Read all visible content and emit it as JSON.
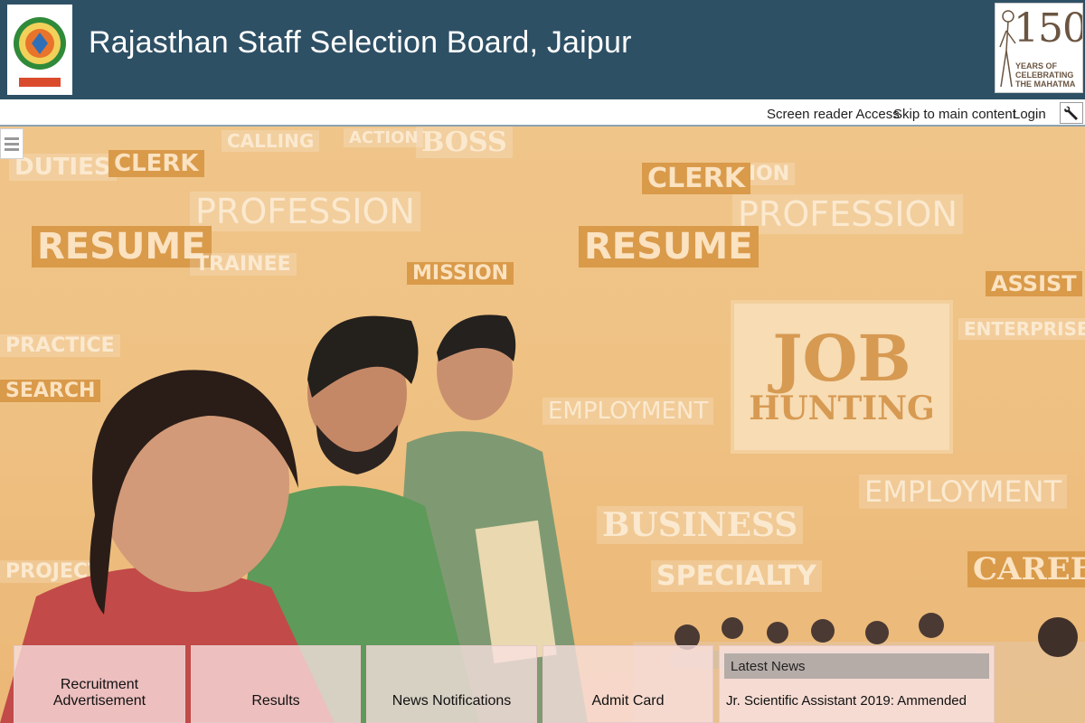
{
  "header": {
    "title": "Rajasthan Staff Selection Board, Jaipur",
    "logo_icon": "rssb-emblem-icon",
    "anniversary": {
      "number": "150",
      "lines": [
        "YEARS OF",
        "CELEBRATING",
        "THE MAHATMA"
      ]
    }
  },
  "top_links": {
    "screen_reader": "Screen reader Access",
    "skip": "Skip to main content",
    "login": "Login",
    "tools_icon": "wrench-icon"
  },
  "hero": {
    "words": [
      "DUTIES",
      "CLERK",
      "CALLING",
      "ACTION",
      "BOSS",
      "PROFESSION",
      "RESUME",
      "TRAINEE",
      "MISSION",
      "PRACTICE",
      "SEARCH",
      "EMPLOYMENT",
      "BUSINESS",
      "SPECIALTY",
      "CAREER",
      "EMPLOYMENT",
      "ENTERPRISE",
      "ASSIST",
      "VOCATION",
      "PROJECT"
    ],
    "job_card": {
      "line1": "JOB",
      "line2": "HUNTING"
    }
  },
  "tiles": [
    {
      "label": "Recruitment Advertisement"
    },
    {
      "label": "Results"
    },
    {
      "label": "News Notifications"
    },
    {
      "label": "Admit Card"
    }
  ],
  "news": {
    "title": "Latest News",
    "items": [
      "Jr. Scientific Assistant 2019: Ammended"
    ]
  },
  "colors": {
    "header_bg": "#2e5065",
    "hero_tint": "#efc284",
    "tile_bg": "#f8e0e0"
  }
}
